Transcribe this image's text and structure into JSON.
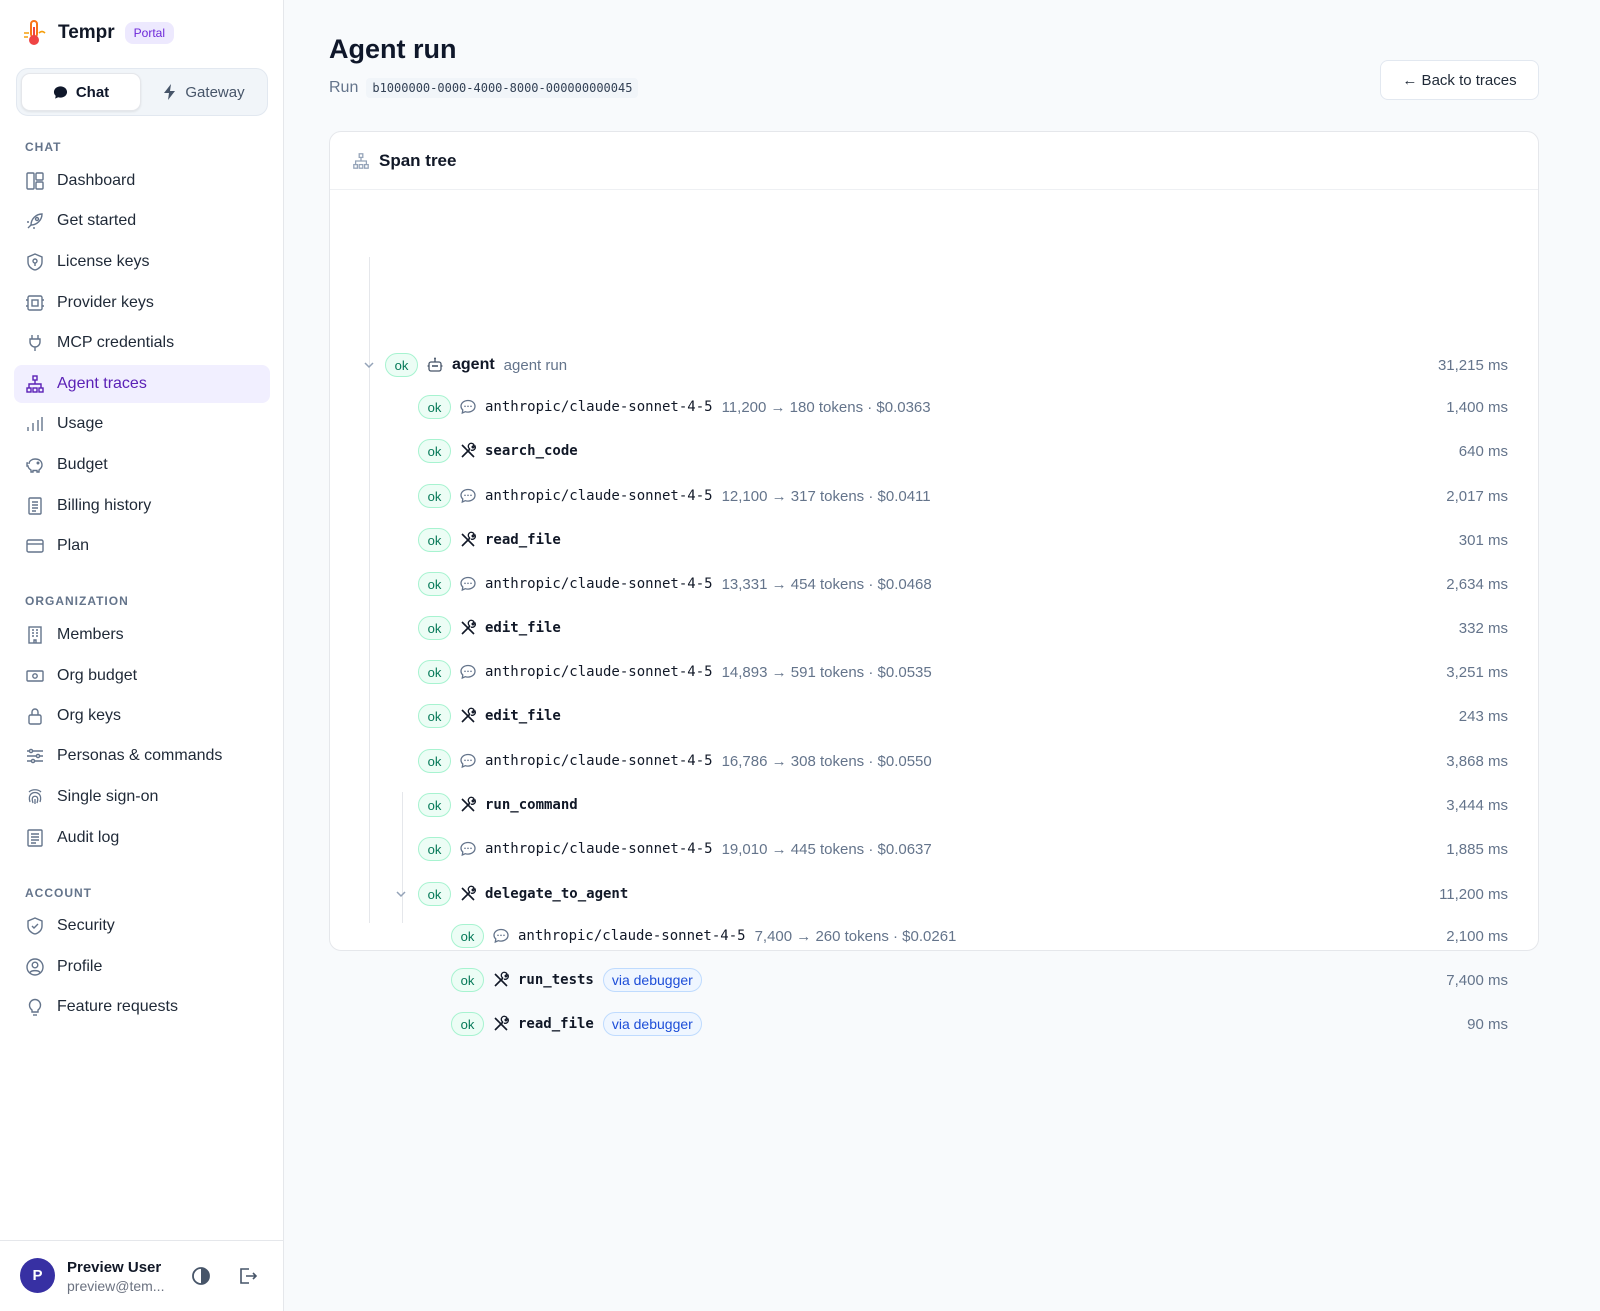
{
  "brand": {
    "name": "Tempr",
    "badge": "Portal"
  },
  "mode_toggle": {
    "chat": "Chat",
    "gateway": "Gateway"
  },
  "sidebar": {
    "sections": {
      "chat": "CHAT",
      "organization": "ORGANIZATION",
      "account": "ACCOUNT"
    },
    "chat_items": [
      {
        "label": "Dashboard",
        "icon": "dashboard-icon"
      },
      {
        "label": "Get started",
        "icon": "rocket-icon"
      },
      {
        "label": "License keys",
        "icon": "shield-key-icon"
      },
      {
        "label": "Provider keys",
        "icon": "provider-icon"
      },
      {
        "label": "MCP credentials",
        "icon": "plug-icon"
      },
      {
        "label": "Agent traces",
        "icon": "tree-icon",
        "active": true
      },
      {
        "label": "Usage",
        "icon": "bar-chart-icon"
      },
      {
        "label": "Budget",
        "icon": "piggy-bank-icon"
      },
      {
        "label": "Billing history",
        "icon": "receipt-icon"
      },
      {
        "label": "Plan",
        "icon": "credit-card-icon"
      }
    ],
    "org_items": [
      {
        "label": "Members",
        "icon": "building-icon"
      },
      {
        "label": "Org budget",
        "icon": "cash-icon"
      },
      {
        "label": "Org keys",
        "icon": "lock-icon"
      },
      {
        "label": "Personas & commands",
        "icon": "sliders-icon"
      },
      {
        "label": "Single sign-on",
        "icon": "fingerprint-icon"
      },
      {
        "label": "Audit log",
        "icon": "log-icon"
      }
    ],
    "account_items": [
      {
        "label": "Security",
        "icon": "shield-check-icon"
      },
      {
        "label": "Profile",
        "icon": "user-circle-icon"
      },
      {
        "label": "Feature requests",
        "icon": "lightbulb-icon"
      }
    ]
  },
  "user": {
    "initial": "P",
    "name": "Preview User",
    "email": "preview@tem..."
  },
  "page": {
    "title": "Agent run",
    "run_label": "Run",
    "run_id": "b1000000-0000-4000-8000-000000000045",
    "back_button": "← Back to traces"
  },
  "span_tree": {
    "title": "Span tree",
    "root": {
      "status": "ok",
      "name": "agent",
      "meta": "agent run",
      "duration": "31,215 ms"
    },
    "spans": [
      {
        "status": "ok",
        "kind": "llm",
        "name": "anthropic/claude-sonnet-4-5",
        "meta": "11,200 → 180 tokens · $0.0363",
        "duration": "1,400 ms"
      },
      {
        "status": "ok",
        "kind": "tool",
        "name": "search_code",
        "meta": "",
        "duration": "640 ms"
      },
      {
        "status": "ok",
        "kind": "llm",
        "name": "anthropic/claude-sonnet-4-5",
        "meta": "12,100 → 317 tokens · $0.0411",
        "duration": "2,017 ms"
      },
      {
        "status": "ok",
        "kind": "tool",
        "name": "read_file",
        "meta": "",
        "duration": "301 ms"
      },
      {
        "status": "ok",
        "kind": "llm",
        "name": "anthropic/claude-sonnet-4-5",
        "meta": "13,331 → 454 tokens · $0.0468",
        "duration": "2,634 ms"
      },
      {
        "status": "ok",
        "kind": "tool",
        "name": "edit_file",
        "meta": "",
        "duration": "332 ms"
      },
      {
        "status": "ok",
        "kind": "llm",
        "name": "anthropic/claude-sonnet-4-5",
        "meta": "14,893 → 591 tokens · $0.0535",
        "duration": "3,251 ms"
      },
      {
        "status": "ok",
        "kind": "tool",
        "name": "edit_file",
        "meta": "",
        "duration": "243 ms"
      },
      {
        "status": "ok",
        "kind": "llm",
        "name": "anthropic/claude-sonnet-4-5",
        "meta": "16,786 → 308 tokens · $0.0550",
        "duration": "3,868 ms"
      },
      {
        "status": "ok",
        "kind": "tool",
        "name": "run_command",
        "meta": "",
        "duration": "3,444 ms"
      },
      {
        "status": "ok",
        "kind": "llm",
        "name": "anthropic/claude-sonnet-4-5",
        "meta": "19,010 → 445 tokens · $0.0637",
        "duration": "1,885 ms"
      },
      {
        "status": "ok",
        "kind": "tool",
        "name": "delegate_to_agent",
        "meta": "",
        "duration": "11,200 ms",
        "expandable": true
      }
    ],
    "children": [
      {
        "status": "ok",
        "kind": "llm",
        "name": "anthropic/claude-sonnet-4-5",
        "meta": "7,400 → 260 tokens · $0.0261",
        "duration": "2,100 ms"
      },
      {
        "status": "ok",
        "kind": "tool",
        "name": "run_tests",
        "via": "via debugger",
        "duration": "7,400 ms"
      },
      {
        "status": "ok",
        "kind": "tool",
        "name": "read_file",
        "via": "via debugger",
        "duration": "90 ms"
      }
    ]
  }
}
